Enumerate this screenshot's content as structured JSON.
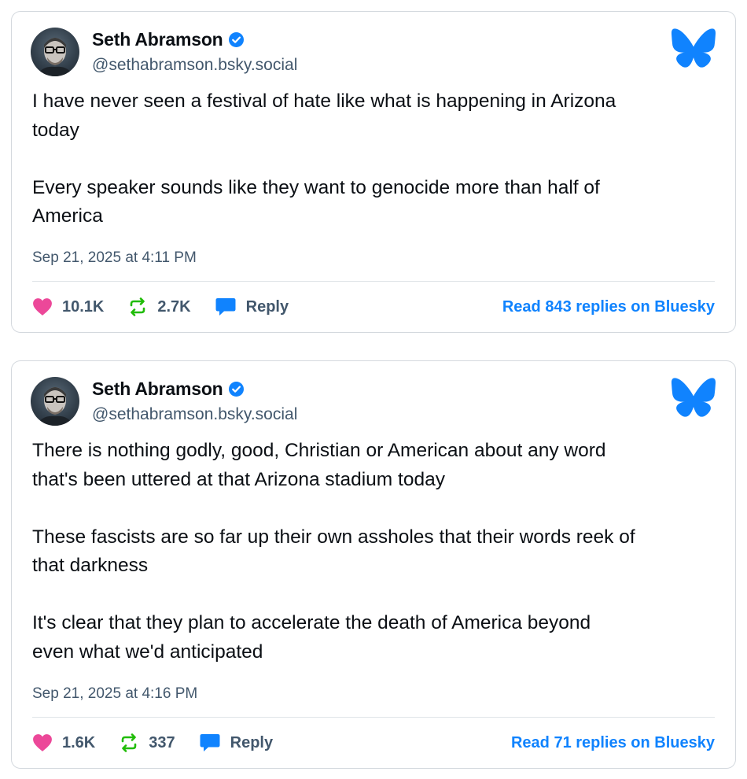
{
  "colors": {
    "like": "#ec4899",
    "repost": "#20bc07",
    "reply": "#1083fe",
    "link": "#1083fe",
    "verified": "#1083fe",
    "bluesky_logo": "#1083fe"
  },
  "posts": [
    {
      "author": {
        "display_name": "Seth Abramson",
        "handle": "@sethabramson.bsky.social",
        "verified": true
      },
      "text": "I have never seen a festival of hate like what is happening in Arizona\ntoday\n\nEvery speaker sounds like they want to genocide more than half of\nAmerica",
      "timestamp": "Sep 21, 2025 at 4:11 PM",
      "likes": "10.1K",
      "reposts": "2.7K",
      "reply_label": "Reply",
      "read_replies_label": "Read 843 replies on Bluesky",
      "icons": [
        "heart-icon",
        "repost-icon",
        "reply-icon",
        "bluesky-butterfly-icon",
        "verified-badge-icon"
      ]
    },
    {
      "author": {
        "display_name": "Seth Abramson",
        "handle": "@sethabramson.bsky.social",
        "verified": true
      },
      "text": "There is nothing godly, good, Christian or American about any word\nthat's been uttered at that Arizona stadium today\n\nThese fascists are so far up their own assholes that their words reek of\nthat darkness\n\nIt's clear that they plan to accelerate the death of America beyond\neven what we'd anticipated",
      "timestamp": "Sep 21, 2025 at 4:16 PM",
      "likes": "1.6K",
      "reposts": "337",
      "reply_label": "Reply",
      "read_replies_label": "Read 71 replies on Bluesky",
      "icons": [
        "heart-icon",
        "repost-icon",
        "reply-icon",
        "bluesky-butterfly-icon",
        "verified-badge-icon"
      ]
    }
  ]
}
